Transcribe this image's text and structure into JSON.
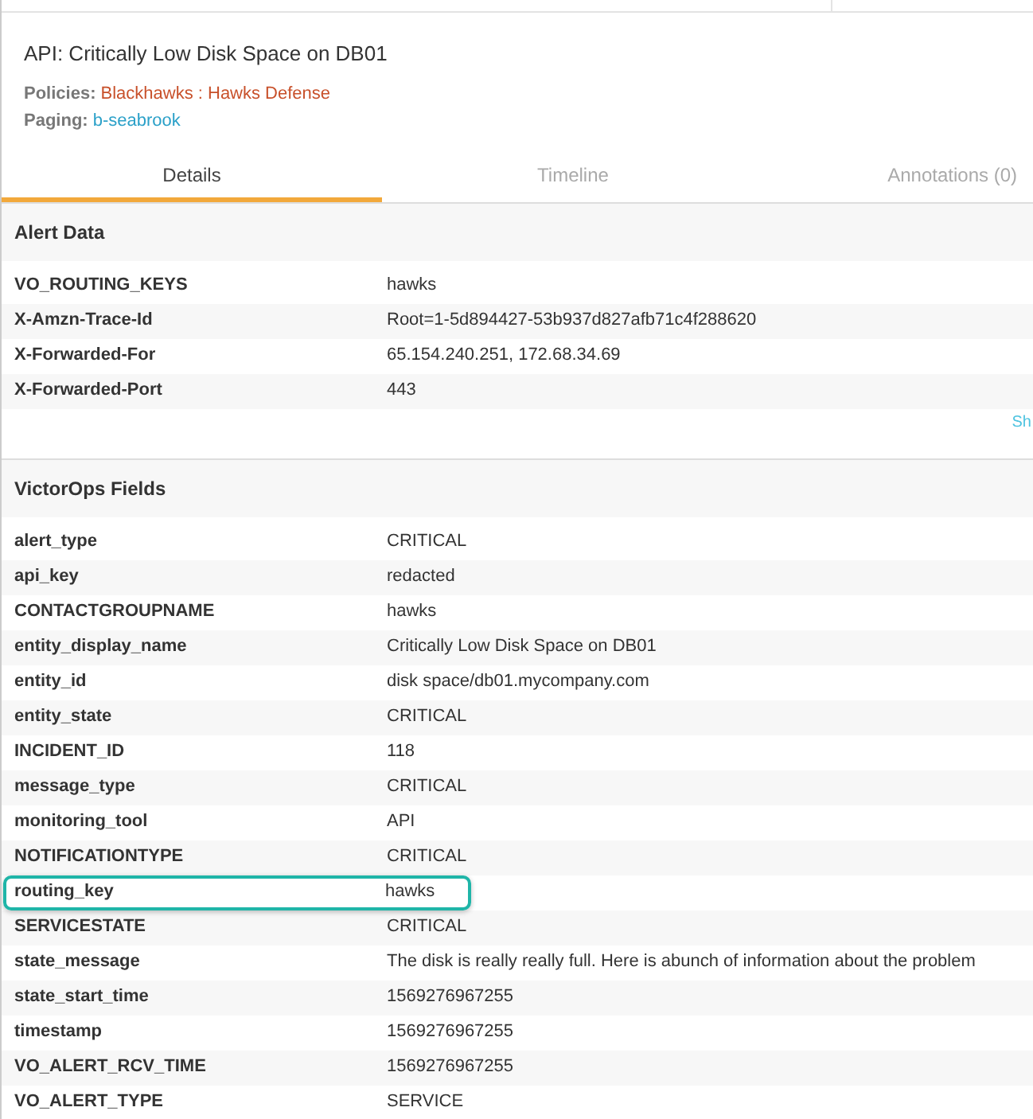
{
  "incident": {
    "title": "API: Critically Low Disk Space on DB01",
    "policies_label": "Policies:",
    "policies": "Blackhawks : Hawks Defense",
    "paging_label": "Paging:",
    "paging": "b-seabrook"
  },
  "tabs": [
    {
      "label": "Details",
      "selected": true
    },
    {
      "label": "Timeline",
      "selected": false
    },
    {
      "label": "Annotations (0)",
      "selected": false
    }
  ],
  "alert_data": {
    "title": "Alert Data",
    "rows": [
      {
        "key": "VO_ROUTING_KEYS",
        "value": "hawks",
        "highlighted": false
      },
      {
        "key": "X-Amzn-Trace-Id",
        "value": "Root=1-5d894427-53b937d827afb71c4f288620",
        "highlighted": false
      },
      {
        "key": "X-Forwarded-For",
        "value": "65.154.240.251, 172.68.34.69",
        "highlighted": false
      },
      {
        "key": "X-Forwarded-Port",
        "value": "443",
        "highlighted": false
      }
    ],
    "link": "Sh"
  },
  "victorops_fields": {
    "title": "VictorOps Fields",
    "rows": [
      {
        "key": "alert_type",
        "value": "CRITICAL",
        "highlighted": false
      },
      {
        "key": "api_key",
        "value": "redacted",
        "highlighted": false
      },
      {
        "key": "CONTACTGROUPNAME",
        "value": "hawks",
        "highlighted": false
      },
      {
        "key": "entity_display_name",
        "value": "Critically Low Disk Space on DB01",
        "highlighted": false
      },
      {
        "key": "entity_id",
        "value": "disk space/db01.mycompany.com",
        "highlighted": false
      },
      {
        "key": "entity_state",
        "value": "CRITICAL",
        "highlighted": false
      },
      {
        "key": "INCIDENT_ID",
        "value": "118",
        "highlighted": false
      },
      {
        "key": "message_type",
        "value": "CRITICAL",
        "highlighted": false
      },
      {
        "key": "monitoring_tool",
        "value": "API",
        "highlighted": false
      },
      {
        "key": "NOTIFICATIONTYPE",
        "value": "CRITICAL",
        "highlighted": false
      },
      {
        "key": "routing_key",
        "value": "hawks",
        "highlighted": true
      },
      {
        "key": "SERVICESTATE",
        "value": "CRITICAL",
        "highlighted": false
      },
      {
        "key": "state_message",
        "value": "The disk is really really full.  Here is abunch of information about the problem",
        "highlighted": false
      },
      {
        "key": "state_start_time",
        "value": "1569276967255",
        "highlighted": false
      },
      {
        "key": "timestamp",
        "value": "1569276967255",
        "highlighted": false
      },
      {
        "key": "VO_ALERT_RCV_TIME",
        "value": "1569276967255",
        "highlighted": false
      },
      {
        "key": "VO_ALERT_TYPE",
        "value": "SERVICE",
        "highlighted": false
      }
    ]
  }
}
